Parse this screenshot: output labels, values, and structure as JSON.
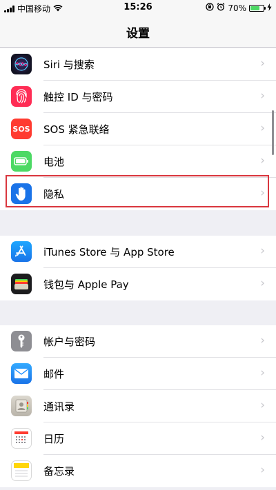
{
  "status": {
    "carrier": "中国移动",
    "time": "15:26",
    "battery_text": "70%",
    "battery_level": 0.7
  },
  "nav": {
    "title": "设置"
  },
  "groups": [
    {
      "items": [
        {
          "label": "Siri 与搜索",
          "icon": "siri-icon",
          "color": "#1a1a2e"
        },
        {
          "label": "触控 ID 与密码",
          "icon": "fingerprint-icon",
          "color": "#ff2d55"
        },
        {
          "label": "SOS 紧急联络",
          "icon": "sos-icon",
          "icon_text": "SOS",
          "color": "#ff3b30"
        },
        {
          "label": "电池",
          "icon": "battery-icon",
          "color": "#4cd964"
        },
        {
          "label": "隐私",
          "icon": "hand-icon",
          "color": "#1a73e8"
        }
      ]
    },
    {
      "items": [
        {
          "label": "iTunes Store 与 App Store",
          "icon": "app-store-icon",
          "color": "#1a8cff"
        },
        {
          "label": "钱包与 Apple Pay",
          "icon": "wallet-icon",
          "color": "#1c1c1e"
        }
      ]
    },
    {
      "items": [
        {
          "label": "帐户与密码",
          "icon": "key-icon",
          "color": "#8e8e93"
        },
        {
          "label": "邮件",
          "icon": "mail-icon",
          "color": "#1a8cff"
        },
        {
          "label": "通讯录",
          "icon": "contacts-icon",
          "color": "#c7c2b8"
        },
        {
          "label": "日历",
          "icon": "calendar-icon",
          "color": "#ffffff"
        },
        {
          "label": "备忘录",
          "icon": "notes-icon",
          "color": "#ffd60a"
        }
      ]
    }
  ],
  "chevron": "›"
}
